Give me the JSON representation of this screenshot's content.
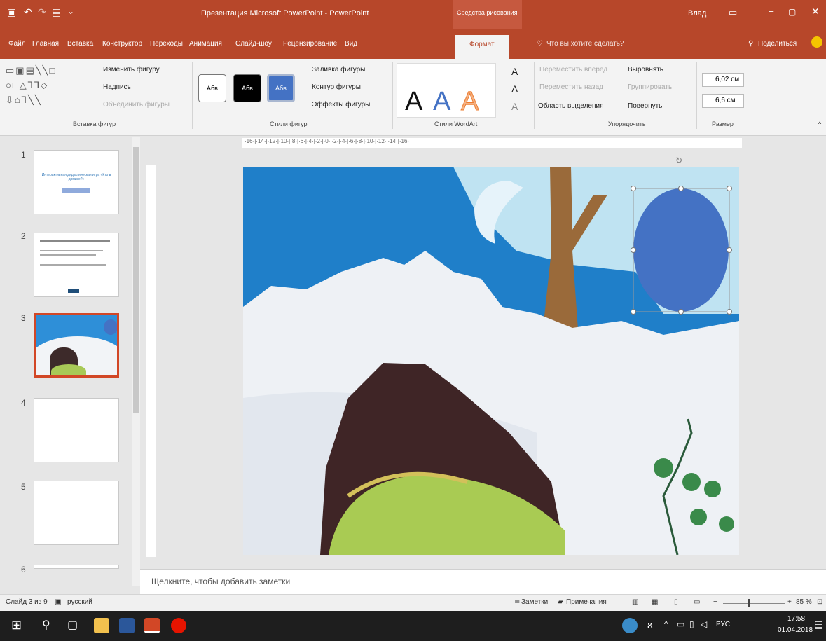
{
  "titlebar": {
    "title": "Презентация Microsoft PowerPoint - PowerPoint",
    "context_tab": "Средства рисования",
    "user": "Влад"
  },
  "tabs": [
    "Файл",
    "Главная",
    "Вставка",
    "Конструктор",
    "Переходы",
    "Анимация",
    "Слайд-шоу",
    "Рецензирование",
    "Вид",
    "Формат"
  ],
  "tell_me": "Что вы хотите сделать?",
  "share": "Поделиться",
  "ribbon": {
    "insert_shapes": {
      "change_shape": "Изменить фигуру",
      "text_box": "Надпись",
      "merge_shapes": "Объединить фигуры",
      "label": "Вставка фигур"
    },
    "shape_styles": {
      "preset_text": "Абв",
      "fill": "Заливка фигуры",
      "outline": "Контур фигуры",
      "effects": "Эффекты фигуры",
      "label": "Стили фигур"
    },
    "wordart": {
      "letter": "A",
      "label": "Стили WordArt"
    },
    "arrange": {
      "bring_forward": "Переместить вперед",
      "send_backward": "Переместить назад",
      "selection_pane": "Область выделения",
      "align": "Выровнять",
      "group": "Группировать",
      "rotate": "Повернуть",
      "label": "Упорядочить"
    },
    "size": {
      "height": "6,02 см",
      "width": "6,6 см",
      "label": "Размер"
    }
  },
  "ruler": "·16·|·14·|·12·|·10·|·8·|·6·|·4·|·2·|·0·|·2·|·4·|·6·|·8·|·10·|·12·|·14·|·16·",
  "thumbnails": {
    "numbers": [
      "1",
      "2",
      "3",
      "4",
      "5",
      "6"
    ],
    "slide1_title": "Интерактивная дидактическая игра «Кто в домике?»"
  },
  "notes_placeholder": "Щелкните, чтобы добавить заметки",
  "status": {
    "slide_info": "Слайд 3 из 9",
    "language": "русский",
    "notes": "Заметки",
    "comments": "Примечания",
    "zoom": "85 %"
  },
  "taskbar": {
    "time": "17:58",
    "date": "01.04.2018",
    "lang": "РУС"
  },
  "colors": {
    "accent": "#b7472a",
    "shape_fill": "#4472c4"
  }
}
